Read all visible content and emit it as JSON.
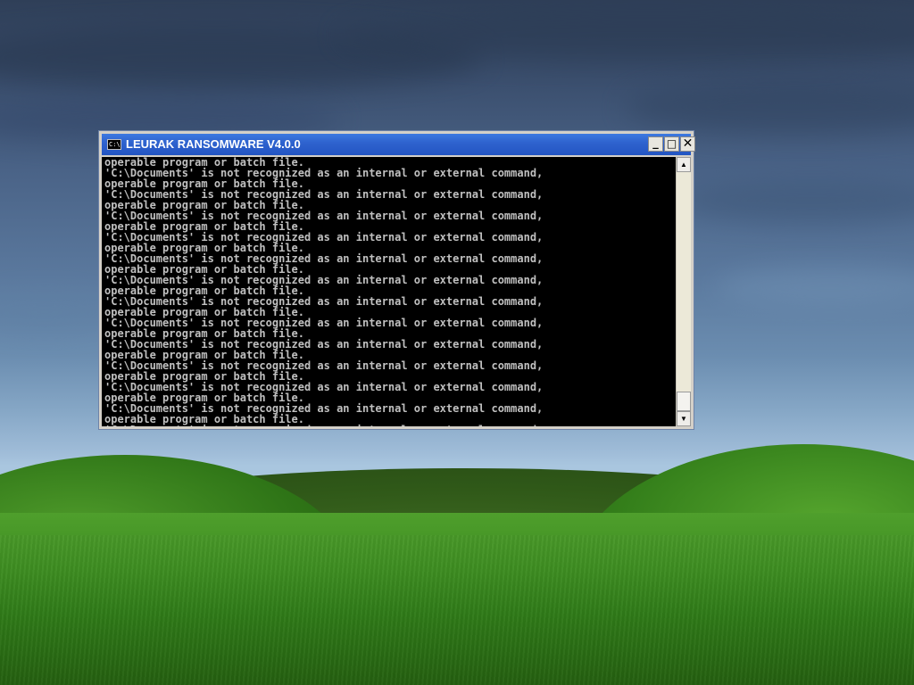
{
  "window": {
    "title": "LEURAK RANSOMWARE V4.0.0",
    "icon_name": "console-icon",
    "icon_glyph": "C:\\",
    "minimize_glyph": "_",
    "maximize_glyph": "□",
    "close_glyph": "✕"
  },
  "console": {
    "lines": [
      "operable program or batch file.",
      "'C:\\Documents' is not recognized as an internal or external command,",
      "operable program or batch file.",
      "'C:\\Documents' is not recognized as an internal or external command,",
      "operable program or batch file.",
      "'C:\\Documents' is not recognized as an internal or external command,",
      "operable program or batch file.",
      "'C:\\Documents' is not recognized as an internal or external command,",
      "operable program or batch file.",
      "'C:\\Documents' is not recognized as an internal or external command,",
      "operable program or batch file.",
      "'C:\\Documents' is not recognized as an internal or external command,",
      "operable program or batch file.",
      "'C:\\Documents' is not recognized as an internal or external command,",
      "operable program or batch file.",
      "'C:\\Documents' is not recognized as an internal or external command,",
      "operable program or batch file.",
      "'C:\\Documents' is not recognized as an internal or external command,",
      "operable program or batch file.",
      "'C:\\Documents' is not recognized as an internal or external command,",
      "operable program or batch file.",
      "'C:\\Documents' is not recognized as an internal or external command,",
      "operable program or batch file.",
      "'C:\\Documents' is not recognized as an internal or external command,",
      "operable program or batch file.",
      "'C:\\Documents' is not recognized as an internal or external command,"
    ]
  },
  "scrollbar": {
    "up_glyph": "▲",
    "down_glyph": "▼"
  },
  "colors": {
    "titlebar": "#2f63cf",
    "console_bg": "#000000",
    "console_text": "#c0c0c0"
  }
}
